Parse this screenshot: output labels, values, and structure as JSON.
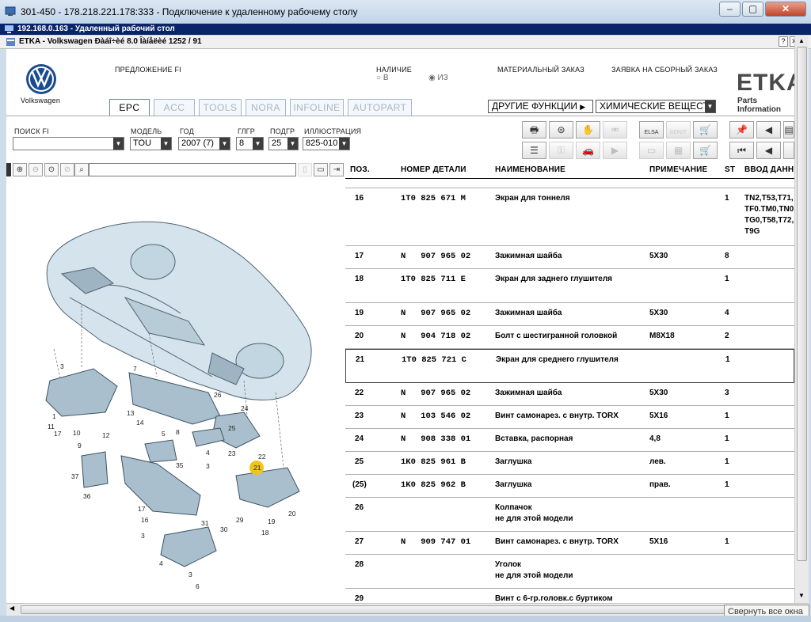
{
  "outer_window": {
    "title": "301-450 - 178.218.221.178:333 - Подключение к удаленному рабочему столу"
  },
  "rdp_bar": {
    "label": "192.168.0.163 - Удаленный рабочий стол"
  },
  "inner_window": {
    "title": "ETKA - Volkswagen Ðàáî÷èé 8.0 Îàíåëèé 1252 / 91"
  },
  "header": {
    "brand_label": "Volkswagen",
    "offer_label": "ПРЕДЛОЖЕНИЕ FI",
    "availability_label": "НАЛИЧИЕ",
    "radio_in": "В",
    "radio_from": "ИЗ",
    "material_order_label": "МАТЕРИАЛЬНЫЙ ЗАКАЗ",
    "assembly_order_label": "ЗАЯВКА НА СБОРНЫЙ ЗАКАЗ",
    "other_functions": "ДРУГИЕ ФУНКЦИИ",
    "chemicals": "ХИМИЧЕСКИЕ ВЕЩЕСТВА",
    "etka_logo": "ETKA",
    "etka_sub": "Parts Information",
    "tabs": [
      {
        "label": "EPC",
        "active": true
      },
      {
        "label": "ACC"
      },
      {
        "label": "TOOLS"
      },
      {
        "label": "NORA"
      },
      {
        "label": "INFOLINE"
      },
      {
        "label": "AUTOPART"
      }
    ]
  },
  "filters": {
    "search_label": "ПОИСК FI",
    "search_value": "",
    "model_label": "МОДЕЛЬ",
    "model_value": "TOU",
    "year_label": "ГОД",
    "year_value": "2007 (7)",
    "glgr_label": "ГЛГР",
    "glgr_value": "8",
    "podgr_label": "ПОДГР",
    "podgr_value": "25",
    "illustration_label": "ИЛЛЮСТРАЦИЯ",
    "illustration_value": "825-010"
  },
  "toolbar_icons": {
    "elsa": "ELSA",
    "depot": "DEPOT"
  },
  "table": {
    "headers": {
      "pos": "ПОЗ.",
      "part_number": "НОМЕР ДЕТАЛИ",
      "name": "НАИМЕНОВАНИЕ",
      "note": "ПРИМЕЧАНИЕ",
      "st": "ST",
      "input": "ВВОД ДАННЫХ"
    },
    "rows": [
      {
        "pos": "16",
        "num": "1T0 825 671 M",
        "name": "Экран для тоннеля",
        "note": "",
        "st": "1",
        "input": "TN2,T53,T71,",
        "input2": "TF0.TM0,TN0,",
        "input3": "TG0,T58,T72,",
        "input4": "T9G"
      },
      {
        "pos": "17",
        "num": "N   907 965 02",
        "name": "Зажимная шайба",
        "note": "5X30",
        "st": "8"
      },
      {
        "pos": "18",
        "num": "1T0 825 711 E",
        "name": "Экран для заднего глушителя",
        "note": "",
        "st": "1"
      },
      {
        "pos": "19",
        "num": "N   907 965 02",
        "name": "Зажимная шайба",
        "note": "5X30",
        "st": "4"
      },
      {
        "pos": "20",
        "num": "N   904 718 02",
        "name": "Болт с шестигранной головкой",
        "note": "M8X18",
        "st": "2"
      },
      {
        "pos": "21",
        "num": "1T0 825 721 C",
        "name": "Экран для среднего глушителя",
        "note": "",
        "st": "1"
      },
      {
        "pos": "22",
        "num": "N   907 965 02",
        "name": "Зажимная шайба",
        "note": "5X30",
        "st": "3"
      },
      {
        "pos": "23",
        "num": "N   103 546 02",
        "name": "Винт самонарез. с внутр. TORX",
        "note": "5X16",
        "st": "1"
      },
      {
        "pos": "24",
        "num": "N   908 338 01",
        "name": "Вставка, распорная",
        "note": "4,8",
        "st": "1"
      },
      {
        "pos": "25",
        "num": "1K0 825 961 B",
        "name": "Заглушка",
        "note": "лев.",
        "st": "1"
      },
      {
        "pos": "(25)",
        "num": "1K0 825 962 B",
        "name": "Заглушка",
        "note": "прав.",
        "st": "1"
      },
      {
        "pos": "26",
        "num": "",
        "name": "Колпачок",
        "name2": "не для этой модели",
        "note": "",
        "st": ""
      },
      {
        "pos": "27",
        "num": "N   909 747 01",
        "name": "Винт самонарез. с внутр. TORX",
        "note": "5X16",
        "st": "1"
      },
      {
        "pos": "28",
        "num": "",
        "name": "Уголок",
        "name2": "не для этой модели",
        "note": "",
        "st": ""
      },
      {
        "pos": "29",
        "num": "",
        "name": "Винт с 6-гр.головк.с буртиком",
        "note": "",
        "st": ""
      }
    ]
  },
  "diagram": {
    "callouts": [
      "3",
      "7",
      "26",
      "1",
      "11",
      "17",
      "10",
      "12",
      "9",
      "13",
      "14",
      "5",
      "8",
      "24",
      "25",
      "23",
      "4",
      "3",
      "22",
      "21",
      "35",
      "37",
      "36",
      "17",
      "16",
      "31",
      "30",
      "29",
      "19",
      "18",
      "20",
      "3",
      "4",
      "3",
      "6"
    ],
    "highlight": "21"
  },
  "tooltip": "Свернуть все окна",
  "colors": {
    "titlebar": "#0a246a",
    "car_fill": "#cfe0ea",
    "highlight": "#f0c419"
  }
}
